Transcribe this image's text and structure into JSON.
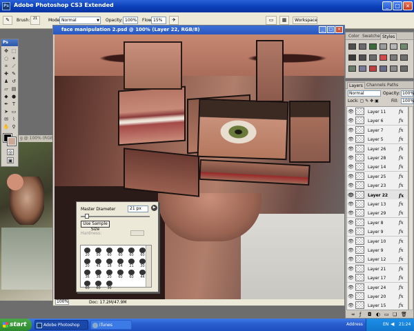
{
  "app": {
    "title": "Adobe Photoshop CS3 Extended"
  },
  "options_bar": {
    "brush_label": "Brush:",
    "brush_size": "21",
    "mode_label": "Mode:",
    "mode_value": "Normal",
    "opacity_label": "Opacity:",
    "opacity_value": "100%",
    "flow_label": "Flow:",
    "flow_value": "15%",
    "workspace_label": "Workspace"
  },
  "tools": {
    "logo": "Ps"
  },
  "bg_document": {
    "title": "g @ 100% (RGB/8)"
  },
  "document": {
    "title": "face manipulation 2.psd @ 100% (Layer 22, RGB/8)",
    "zoom": "100%",
    "doc_info": "Doc: 17.2M/47.9M"
  },
  "brush_picker": {
    "master_diameter_label": "Master Diameter",
    "diameter_value": "21 px",
    "use_sample_label": "Use Sample Size",
    "hardness_label": "Hardness:",
    "presets": [
      "20",
      "50",
      "60",
      "60",
      "60",
      "60",
      "20",
      "45",
      "18",
      "64",
      "21",
      "30",
      "36",
      "36",
      "20",
      "60",
      "60",
      "44",
      "60",
      "60",
      "30"
    ]
  },
  "color_panel": {
    "tabs": [
      "Color",
      "Swatches",
      "Styles"
    ],
    "swatches": [
      "#4f4f4f",
      "#6b6b6b",
      "#3a6b3a",
      "#9b9b9b",
      "#b5b5b5",
      "#6f8a6f",
      "#3a3a3a",
      "#505050",
      "#6b6b6b",
      "#d44a4a",
      "#7a7a7a",
      "#6f6f6f",
      "#6a7d6a",
      "#7a7a9a",
      "#c04040",
      "#6a6a8a",
      "#8a8a8a",
      "#6a6a6a"
    ]
  },
  "layers_panel": {
    "tabs": [
      "Layers",
      "Channels",
      "Paths"
    ],
    "blend_mode": "Normal",
    "opacity_label": "Opacity:",
    "opacity_value": "100%",
    "lock_label": "Lock:",
    "fill_label": "Fill:",
    "fill_value": "100%",
    "layers": [
      {
        "name": "Layer 11",
        "selected": false
      },
      {
        "name": "Layer 6",
        "selected": false
      },
      {
        "name": "Layer 7",
        "selected": false
      },
      {
        "name": "Layer 5",
        "selected": false
      },
      {
        "name": "Layer 26",
        "selected": false
      },
      {
        "name": "Layer 28",
        "selected": false
      },
      {
        "name": "Layer 14",
        "selected": false
      },
      {
        "name": "Layer 25",
        "selected": false
      },
      {
        "name": "Layer 23",
        "selected": false
      },
      {
        "name": "Layer 22",
        "selected": true
      },
      {
        "name": "Layer 13",
        "selected": false
      },
      {
        "name": "Layer 29",
        "selected": false
      },
      {
        "name": "Layer 8",
        "selected": false
      },
      {
        "name": "Layer 9",
        "selected": false
      },
      {
        "name": "Layer 10",
        "selected": false
      },
      {
        "name": "Layer 9",
        "selected": false
      },
      {
        "name": "Layer 12",
        "selected": false
      },
      {
        "name": "Layer 21",
        "selected": false
      },
      {
        "name": "Layer 17",
        "selected": false
      },
      {
        "name": "Layer 24",
        "selected": false
      },
      {
        "name": "Layer 20",
        "selected": false
      },
      {
        "name": "Layer 15",
        "selected": false
      }
    ]
  },
  "taskbar": {
    "start_label": "start",
    "items": [
      "Adobe Photoshop CS...",
      "iTunes"
    ],
    "address_label": "Address",
    "lang": "EN",
    "time": "21:24"
  }
}
